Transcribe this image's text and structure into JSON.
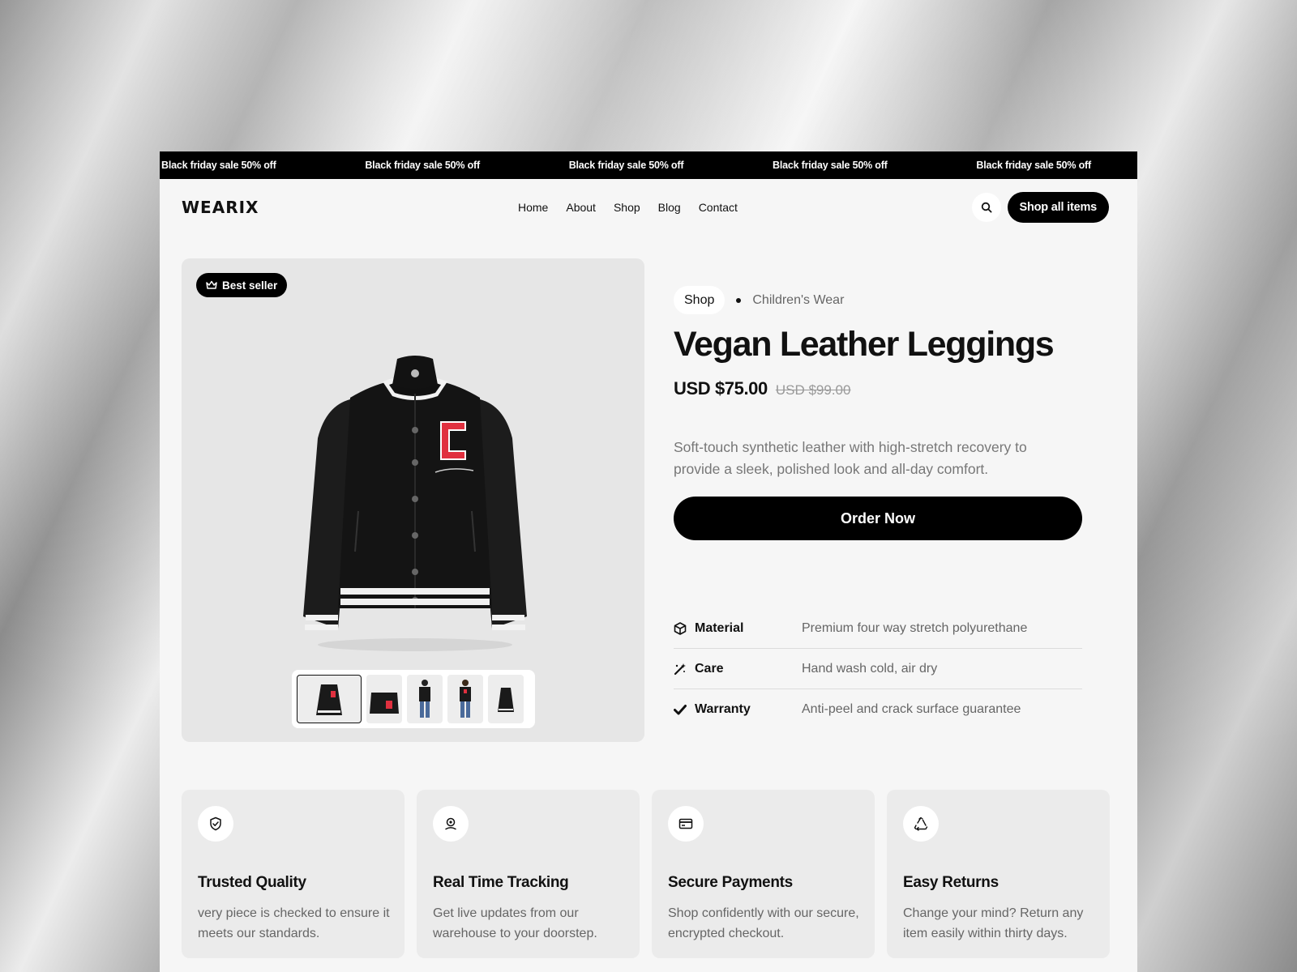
{
  "ticker": {
    "items": [
      "Black friday sale 50% off",
      "Black friday sale 50% off",
      "Black friday sale 50% off",
      "Black friday sale 50% off",
      "Black friday sale 50% off"
    ]
  },
  "nav": {
    "logo": "WEARIX",
    "links": [
      "Home",
      "About",
      "Shop",
      "Blog",
      "Contact"
    ],
    "search_icon": "search-icon",
    "cta": "Shop all items"
  },
  "gallery": {
    "badge": "Best seller",
    "badge_icon": "crown-icon",
    "thumbnails": 5,
    "selected_thumbnail": 1
  },
  "product": {
    "breadcrumb": {
      "parent": "Shop",
      "current": "Children's Wear"
    },
    "title": "Vegan Leather Leggings",
    "price": "USD $75.00",
    "old_price": "USD $99.00",
    "description": "Soft-touch synthetic leather with high-stretch recovery to provide a sleek, polished look and all-day comfort.",
    "order_label": "Order Now",
    "specs": [
      {
        "icon": "box-icon",
        "label": "Material",
        "value": "Premium four way stretch polyurethane"
      },
      {
        "icon": "wand-icon",
        "label": "Care",
        "value": "Hand wash cold, air dry"
      },
      {
        "icon": "check-icon",
        "label": "Warranty",
        "value": "Anti-peel and crack surface guarantee"
      }
    ]
  },
  "features": [
    {
      "icon": "shield-check-icon",
      "title": "Trusted Quality",
      "text": "very piece is checked to ensure it meets our standards."
    },
    {
      "icon": "location-pin-icon",
      "title": "Real Time Tracking",
      "text": "Get live updates from our warehouse to your doorstep."
    },
    {
      "icon": "credit-card-icon",
      "title": "Secure Payments",
      "text": "Shop confidently with our secure, encrypted checkout."
    },
    {
      "icon": "recycle-icon",
      "title": "Easy Returns",
      "text": "Change your mind? Return any item easily within thirty days."
    }
  ],
  "colors": {
    "accent": "#000000",
    "background": "#f6f6f6",
    "card": "#ebebeb",
    "jacket_letter": "#e0303f"
  }
}
